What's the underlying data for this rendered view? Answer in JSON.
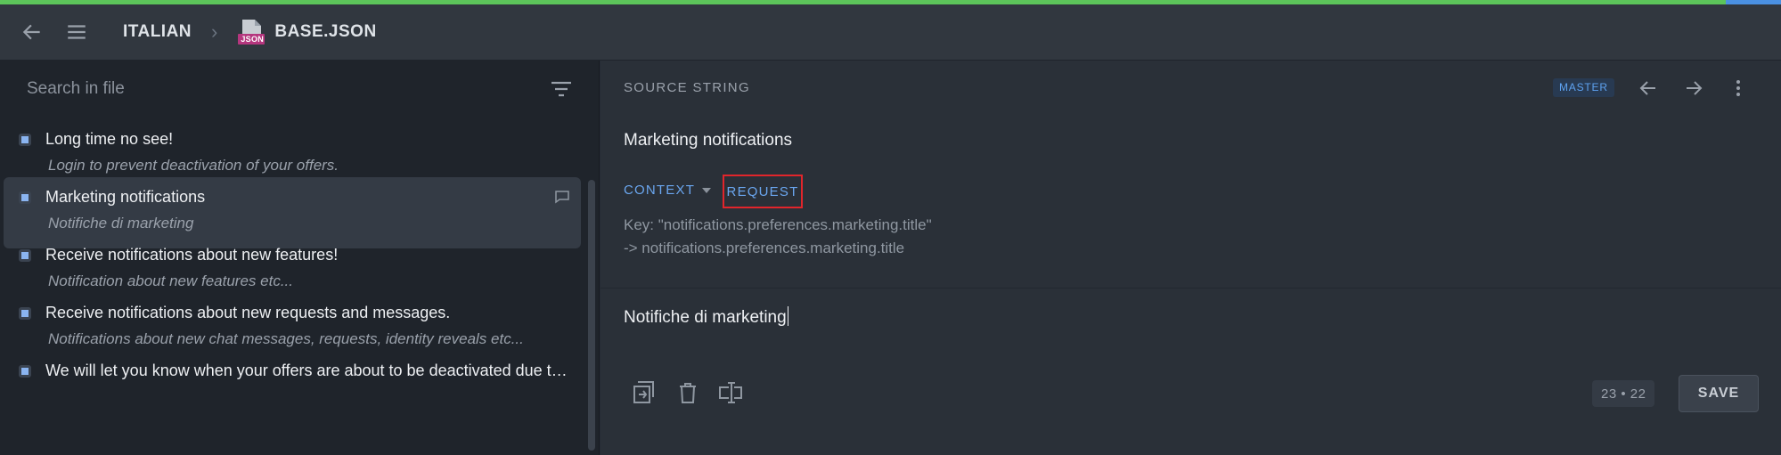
{
  "header": {
    "breadcrumb_project": "ITALIAN",
    "breadcrumb_file": "BASE.JSON",
    "file_icon_label": "JSON"
  },
  "sidebar": {
    "search_placeholder": "Search in file",
    "items": [
      {
        "source": "Long time no see!",
        "translation": "Login to prevent deactivation of your offers.",
        "active": false,
        "has_comment": false
      },
      {
        "source": "Marketing notifications",
        "translation": "Notifiche di marketing",
        "active": true,
        "has_comment": true
      },
      {
        "source": "Receive notifications about new features!",
        "translation": "Notification about new features etc...",
        "active": false,
        "has_comment": false
      },
      {
        "source": "Receive notifications about new requests and messages.",
        "translation": "Notifications about new chat messages, requests, identity reveals etc...",
        "active": false,
        "has_comment": false
      },
      {
        "source": "We will let you know when your offers are about to be deactivated due to inactivity",
        "translation": "",
        "active": false,
        "has_comment": false
      }
    ]
  },
  "editor": {
    "section_label": "SOURCE STRING",
    "badge": "MASTER",
    "source_text": "Marketing notifications",
    "context_label": "CONTEXT",
    "request_label": "REQUEST",
    "key_line": "Key: \"notifications.preferences.marketing.title\"",
    "path_line": "-> notifications.preferences.marketing.title",
    "translation_text": "Notifiche di marketing",
    "counter": "23 • 22",
    "save_label": "SAVE"
  },
  "colors": {
    "accent_green": "#5cc45a",
    "accent_blue": "#6aa6ef",
    "highlight_red": "#e1252b"
  }
}
